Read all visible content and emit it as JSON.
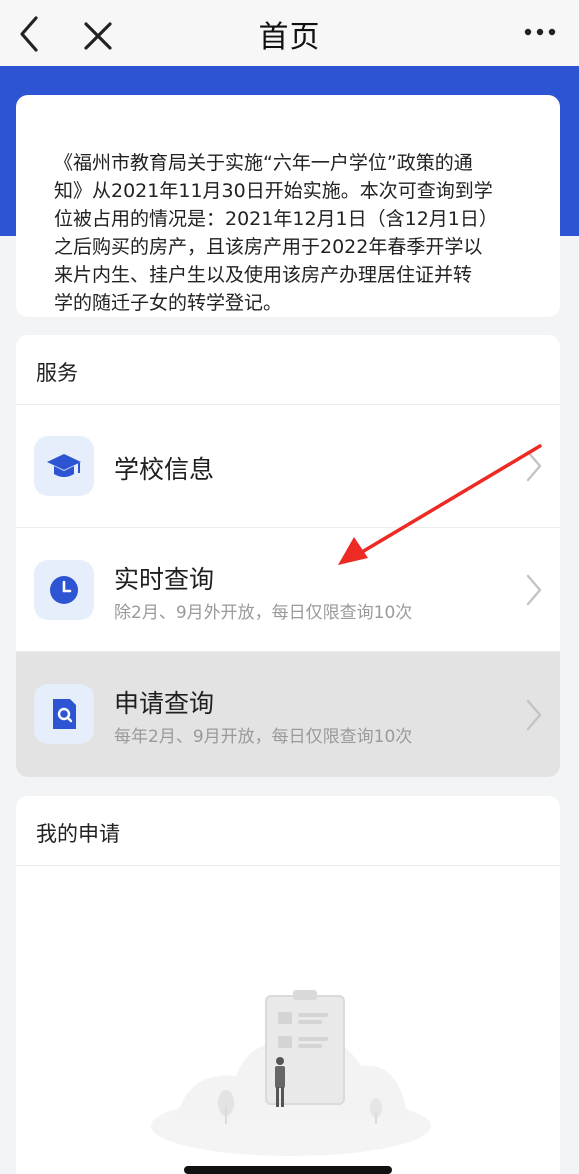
{
  "header": {
    "title": "首页",
    "back_icon": "chevron-left-icon",
    "close_icon": "close-icon",
    "more_icon": "more-dots-icon"
  },
  "notice": {
    "text": "《福州市教育局关于实施“六年一户学位”政策的通\n知》从2021年11月30日开始实施。本次可查询到学\n位被占用的情况是：2021年12月1日（含12月1日）\n之后购买的房产，且该房产用于2022年春季开学以\n来片内生、挂户生以及使用该房产办理居住证并转\n学的随迁子女的转学登记。"
  },
  "services": {
    "title": "服务",
    "items": [
      {
        "title": "学校信息",
        "subtitle": "",
        "icon": "graduation-cap-icon"
      },
      {
        "title": "实时查询",
        "subtitle": "除2月、9月外开放，每日仅限查询10次",
        "icon": "clock-icon"
      },
      {
        "title": "申请查询",
        "subtitle": "每年2月、9月开放，每日仅限查询10次",
        "icon": "document-search-icon"
      }
    ]
  },
  "applications": {
    "title": "我的申请",
    "empty_illustration": "empty-clipboard-illustration"
  },
  "colors": {
    "brand_blue": "#2d54d2",
    "icon_bg": "#e6edfb",
    "annotation_red": "#ee2a24"
  }
}
